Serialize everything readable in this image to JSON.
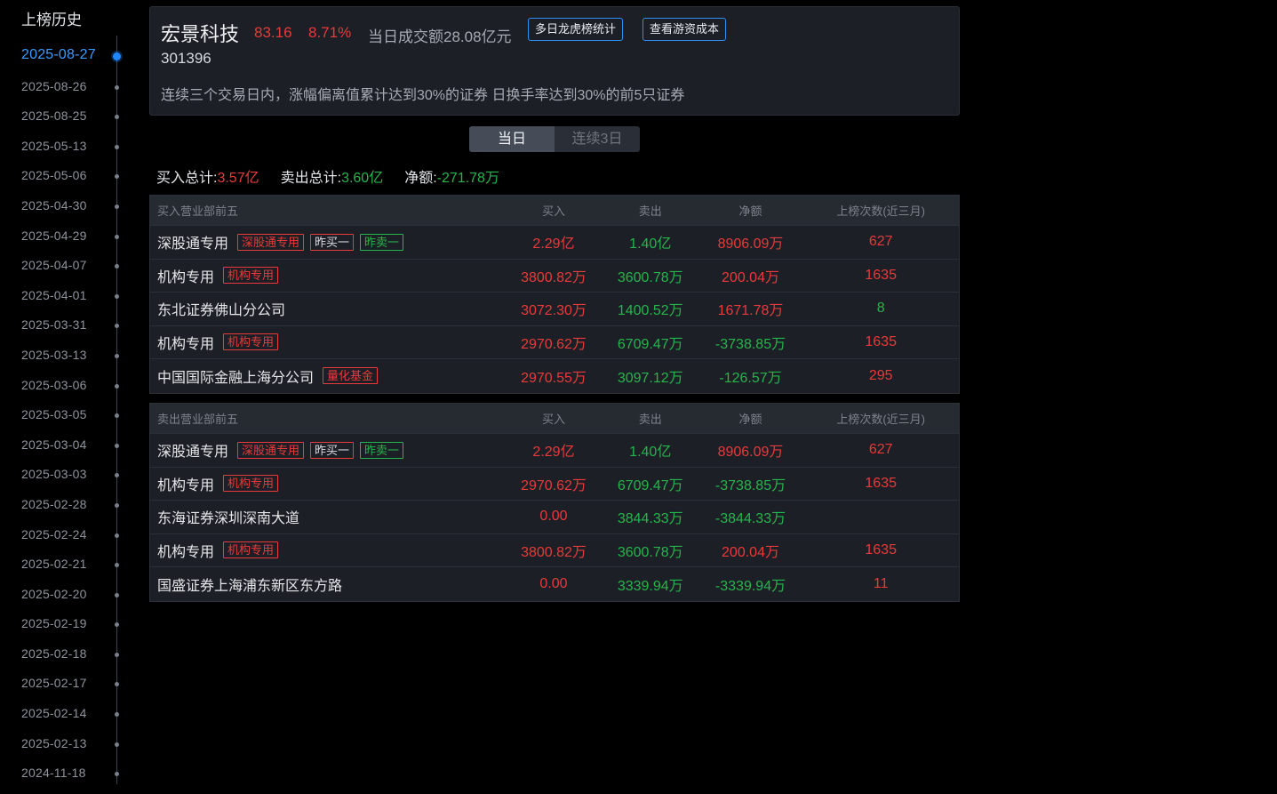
{
  "sidebar": {
    "title": "上榜历史",
    "dates": [
      {
        "date": "2025-08-27",
        "active": true
      },
      {
        "date": "2025-08-26",
        "active": false
      },
      {
        "date": "2025-08-25",
        "active": false
      },
      {
        "date": "2025-05-13",
        "active": false
      },
      {
        "date": "2025-05-06",
        "active": false
      },
      {
        "date": "2025-04-30",
        "active": false
      },
      {
        "date": "2025-04-29",
        "active": false
      },
      {
        "date": "2025-04-07",
        "active": false
      },
      {
        "date": "2025-04-01",
        "active": false
      },
      {
        "date": "2025-03-31",
        "active": false
      },
      {
        "date": "2025-03-13",
        "active": false
      },
      {
        "date": "2025-03-06",
        "active": false
      },
      {
        "date": "2025-03-05",
        "active": false
      },
      {
        "date": "2025-03-04",
        "active": false
      },
      {
        "date": "2025-03-03",
        "active": false
      },
      {
        "date": "2025-02-28",
        "active": false
      },
      {
        "date": "2025-02-24",
        "active": false
      },
      {
        "date": "2025-02-21",
        "active": false
      },
      {
        "date": "2025-02-20",
        "active": false
      },
      {
        "date": "2025-02-19",
        "active": false
      },
      {
        "date": "2025-02-18",
        "active": false
      },
      {
        "date": "2025-02-17",
        "active": false
      },
      {
        "date": "2025-02-14",
        "active": false
      },
      {
        "date": "2025-02-13",
        "active": false
      },
      {
        "date": "2024-11-18",
        "active": false
      }
    ]
  },
  "header": {
    "name": "宏景科技",
    "price": "83.16",
    "change_pct": "8.71%",
    "turnover": "当日成交额28.08亿元",
    "btn_multi_day": "多日龙虎榜统计",
    "btn_cost": "查看游资成本",
    "code": "301396",
    "reasons": "连续三个交易日内，涨幅偏离值累计达到30%的证券 日换手率达到30%的前5只证券"
  },
  "toggle": {
    "options": [
      "当日",
      "连续3日"
    ],
    "active_index": 0
  },
  "summary": {
    "buy_label": "买入总计:",
    "buy_value": "3.57亿",
    "sell_label": "卖出总计:",
    "sell_value": "3.60亿",
    "net_label": "净额:",
    "net_value": "-271.78万"
  },
  "buy_table": {
    "columns": [
      "买入营业部前五",
      "买入",
      "卖出",
      "净额",
      "上榜次数(近三月)"
    ],
    "rows": [
      {
        "name": "深股通专用",
        "tags": [
          {
            "text": "深股通专用",
            "style": "red"
          },
          {
            "text": "昨买一",
            "style": "white"
          },
          {
            "text": "昨卖一",
            "style": "green"
          }
        ],
        "buy": "2.29亿",
        "sell": "1.40亿",
        "net": "8906.09万",
        "net_dir": "red",
        "count": "627"
      },
      {
        "name": "机构专用",
        "tags": [
          {
            "text": "机构专用",
            "style": "red"
          }
        ],
        "buy": "3800.82万",
        "sell": "3600.78万",
        "net": "200.04万",
        "net_dir": "red",
        "count": "1635"
      },
      {
        "name": "东北证券佛山分公司",
        "tags": [],
        "buy": "3072.30万",
        "sell": "1400.52万",
        "net": "1671.78万",
        "net_dir": "red",
        "count": "8",
        "count_dir": "green"
      },
      {
        "name": "机构专用",
        "tags": [
          {
            "text": "机构专用",
            "style": "red"
          }
        ],
        "buy": "2970.62万",
        "sell": "6709.47万",
        "net": "-3738.85万",
        "net_dir": "green",
        "count": "1635"
      },
      {
        "name": "中国国际金融上海分公司",
        "tags": [
          {
            "text": "量化基金",
            "style": "red"
          }
        ],
        "buy": "2970.55万",
        "sell": "3097.12万",
        "net": "-126.57万",
        "net_dir": "green",
        "count": "295"
      }
    ]
  },
  "sell_table": {
    "columns": [
      "卖出营业部前五",
      "买入",
      "卖出",
      "净额",
      "上榜次数(近三月)"
    ],
    "rows": [
      {
        "name": "深股通专用",
        "tags": [
          {
            "text": "深股通专用",
            "style": "red"
          },
          {
            "text": "昨买一",
            "style": "white"
          },
          {
            "text": "昨卖一",
            "style": "green"
          }
        ],
        "buy": "2.29亿",
        "sell": "1.40亿",
        "net": "8906.09万",
        "net_dir": "red",
        "count": "627"
      },
      {
        "name": "机构专用",
        "tags": [
          {
            "text": "机构专用",
            "style": "red"
          }
        ],
        "buy": "2970.62万",
        "sell": "6709.47万",
        "net": "-3738.85万",
        "net_dir": "green",
        "count": "1635"
      },
      {
        "name": "东海证券深圳深南大道",
        "tags": [],
        "buy": "0.00",
        "sell": "3844.33万",
        "net": "-3844.33万",
        "net_dir": "green",
        "count": ""
      },
      {
        "name": "机构专用",
        "tags": [
          {
            "text": "机构专用",
            "style": "red"
          }
        ],
        "buy": "3800.82万",
        "sell": "3600.78万",
        "net": "200.04万",
        "net_dir": "red",
        "count": "1635"
      },
      {
        "name": "国盛证券上海浦东新区东方路",
        "tags": [],
        "buy": "0.00",
        "sell": "3339.94万",
        "net": "-3339.94万",
        "net_dir": "green",
        "count": "11"
      }
    ]
  }
}
